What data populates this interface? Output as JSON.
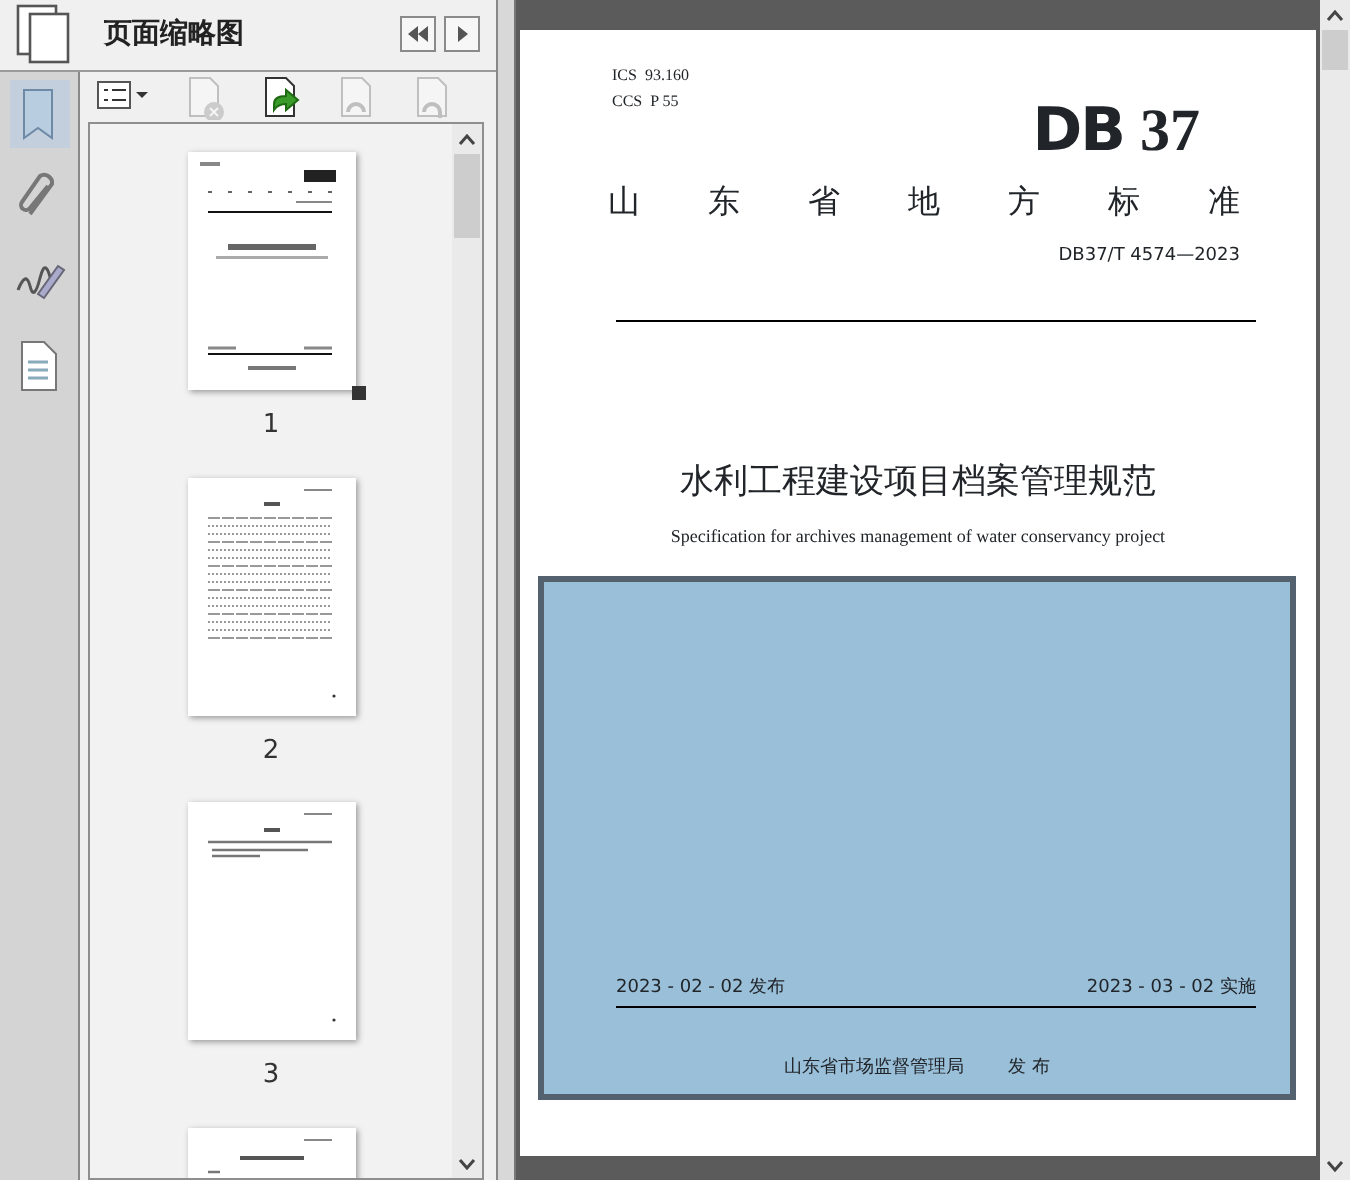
{
  "panel": {
    "title": "页面缩略图"
  },
  "toolbar": [
    {
      "kind": "options",
      "disabled": false
    },
    {
      "kind": "delete",
      "disabled": true
    },
    {
      "kind": "insert",
      "disabled": false
    },
    {
      "kind": "undo",
      "disabled": true
    },
    {
      "kind": "redo",
      "disabled": true
    }
  ],
  "sidebar": {
    "items": [
      {
        "kind": "bookmarks",
        "selected": true
      },
      {
        "kind": "attachments",
        "selected": false
      },
      {
        "kind": "signatures",
        "selected": false
      },
      {
        "kind": "layers",
        "selected": false
      }
    ]
  },
  "thumbnails": [
    {
      "kind": "cover",
      "label": "1",
      "zoom_handle": true
    },
    {
      "kind": "contents",
      "label": "2"
    },
    {
      "kind": "foreword",
      "label": "3"
    },
    {
      "kind": "text"
    }
  ],
  "document": {
    "codes": [
      {
        "label": "ICS",
        "value": "93.160"
      },
      {
        "label": "CCS",
        "value": "P 55"
      }
    ],
    "logo": {
      "prefix": "DB",
      "number": "37"
    },
    "category": "山东省地方标准",
    "standard_number": "DB37/T 4574—2023",
    "title": "水利工程建设项目档案管理规范",
    "subtitle": "Specification for archives management of water conservancy project",
    "issue_date": "2023 - 02 - 02 发布",
    "effective_date": "2023 - 03 - 02 实施",
    "publisher": "山东省市场监督管理局",
    "publish_word": "发 布"
  }
}
